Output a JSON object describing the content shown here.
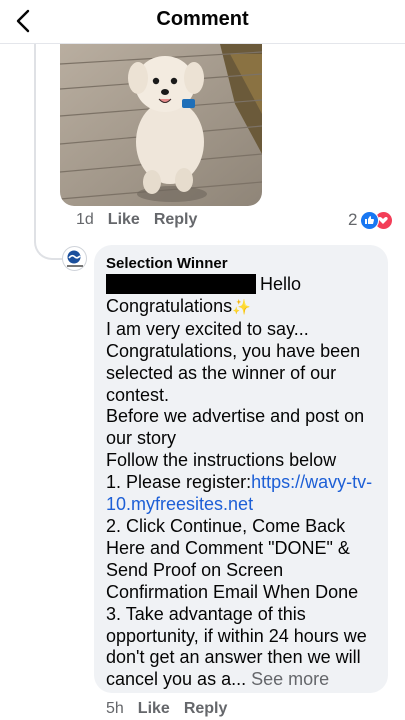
{
  "header": {
    "title": "Comment"
  },
  "parent_comment": {
    "time": "1d",
    "like_label": "Like",
    "reply_label": "Reply",
    "reaction_count": "2"
  },
  "reply_comment": {
    "author": "Selection Winner",
    "greeting": "Hello",
    "line_congrats": "Congratulations",
    "body_before_link": "I am very excited to say...\nCongratulations, you have been selected as the winner of our contest.\nBefore we advertise and post on our story\nFollow the instructions below\n1. Please register:",
    "link_text": "https://wavy-tv-10.myfreesites.net",
    "body_after_link": "2. Click Continue, Come Back Here and Comment \"DONE\" & Send Proof on Screen Confirmation Email When Done\n3. Take advantage of this opportunity, if within 24 hours we don't get an answer then we will cancel you as a... ",
    "see_more": "See more",
    "time": "5h",
    "like_label": "Like",
    "reply_label": "Reply"
  },
  "icons": {
    "back": "chevron-left-icon",
    "like_reaction": "like-reaction-icon",
    "love_reaction": "love-reaction-icon",
    "sparkle": "sparkles-emoji",
    "avatar": "wavy-tv-logo-avatar"
  },
  "colors": {
    "link": "#1d5fd6",
    "like_blue": "#1877f2",
    "love_red": "#f33e58",
    "bubble_bg": "#f0f2f5",
    "muted": "#65676b"
  }
}
